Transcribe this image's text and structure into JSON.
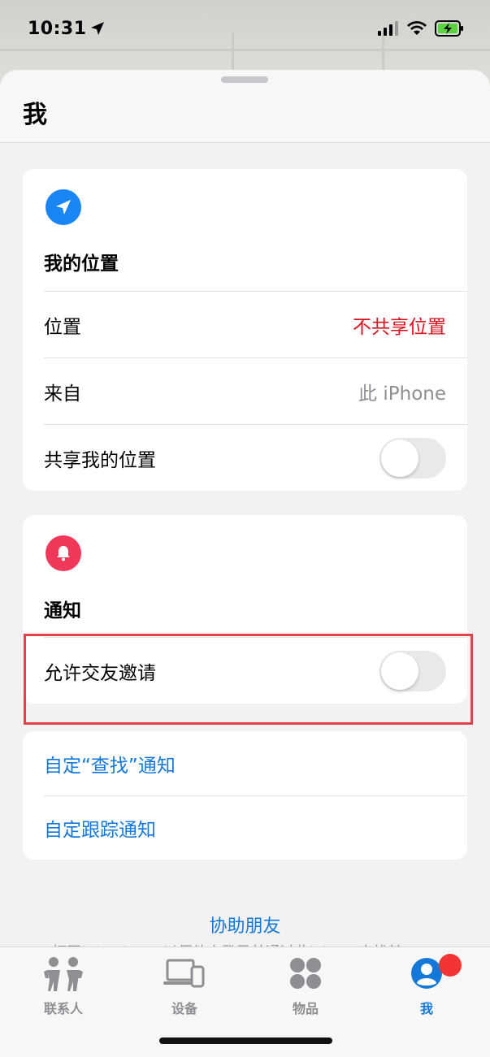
{
  "status_bar": {
    "time": "10:31"
  },
  "sheet": {
    "title": "我"
  },
  "my_location": {
    "title": "我的位置",
    "rows": {
      "location_label": "位置",
      "location_value": "不共享位置",
      "from_label": "来自",
      "from_value": "此 iPhone",
      "share_label": "共享我的位置"
    },
    "share_toggle_on": false
  },
  "notifications": {
    "title": "通知",
    "allow_friend_requests_label": "允许交友邀请",
    "allow_friend_requests_on": false
  },
  "links": {
    "customize_find": "自定“查找”通知",
    "customize_tracking": "自定跟踪通知"
  },
  "help": {
    "title": "协助朋友",
    "subtitle": "打开iCloud.com以便他人登录并通过此iPhone查找其"
  },
  "tabs": [
    {
      "label": "联系人",
      "icon": "people-icon"
    },
    {
      "label": "设备",
      "icon": "devices-icon"
    },
    {
      "label": "物品",
      "icon": "items-icon"
    },
    {
      "label": "我",
      "icon": "me-icon"
    }
  ],
  "colors": {
    "accent_blue": "#1478d8",
    "alert_red": "#d8121e",
    "location_icon_blue": "#1a86f5",
    "bell_icon_red": "#f2385a",
    "highlight_red": "#e0444a"
  }
}
